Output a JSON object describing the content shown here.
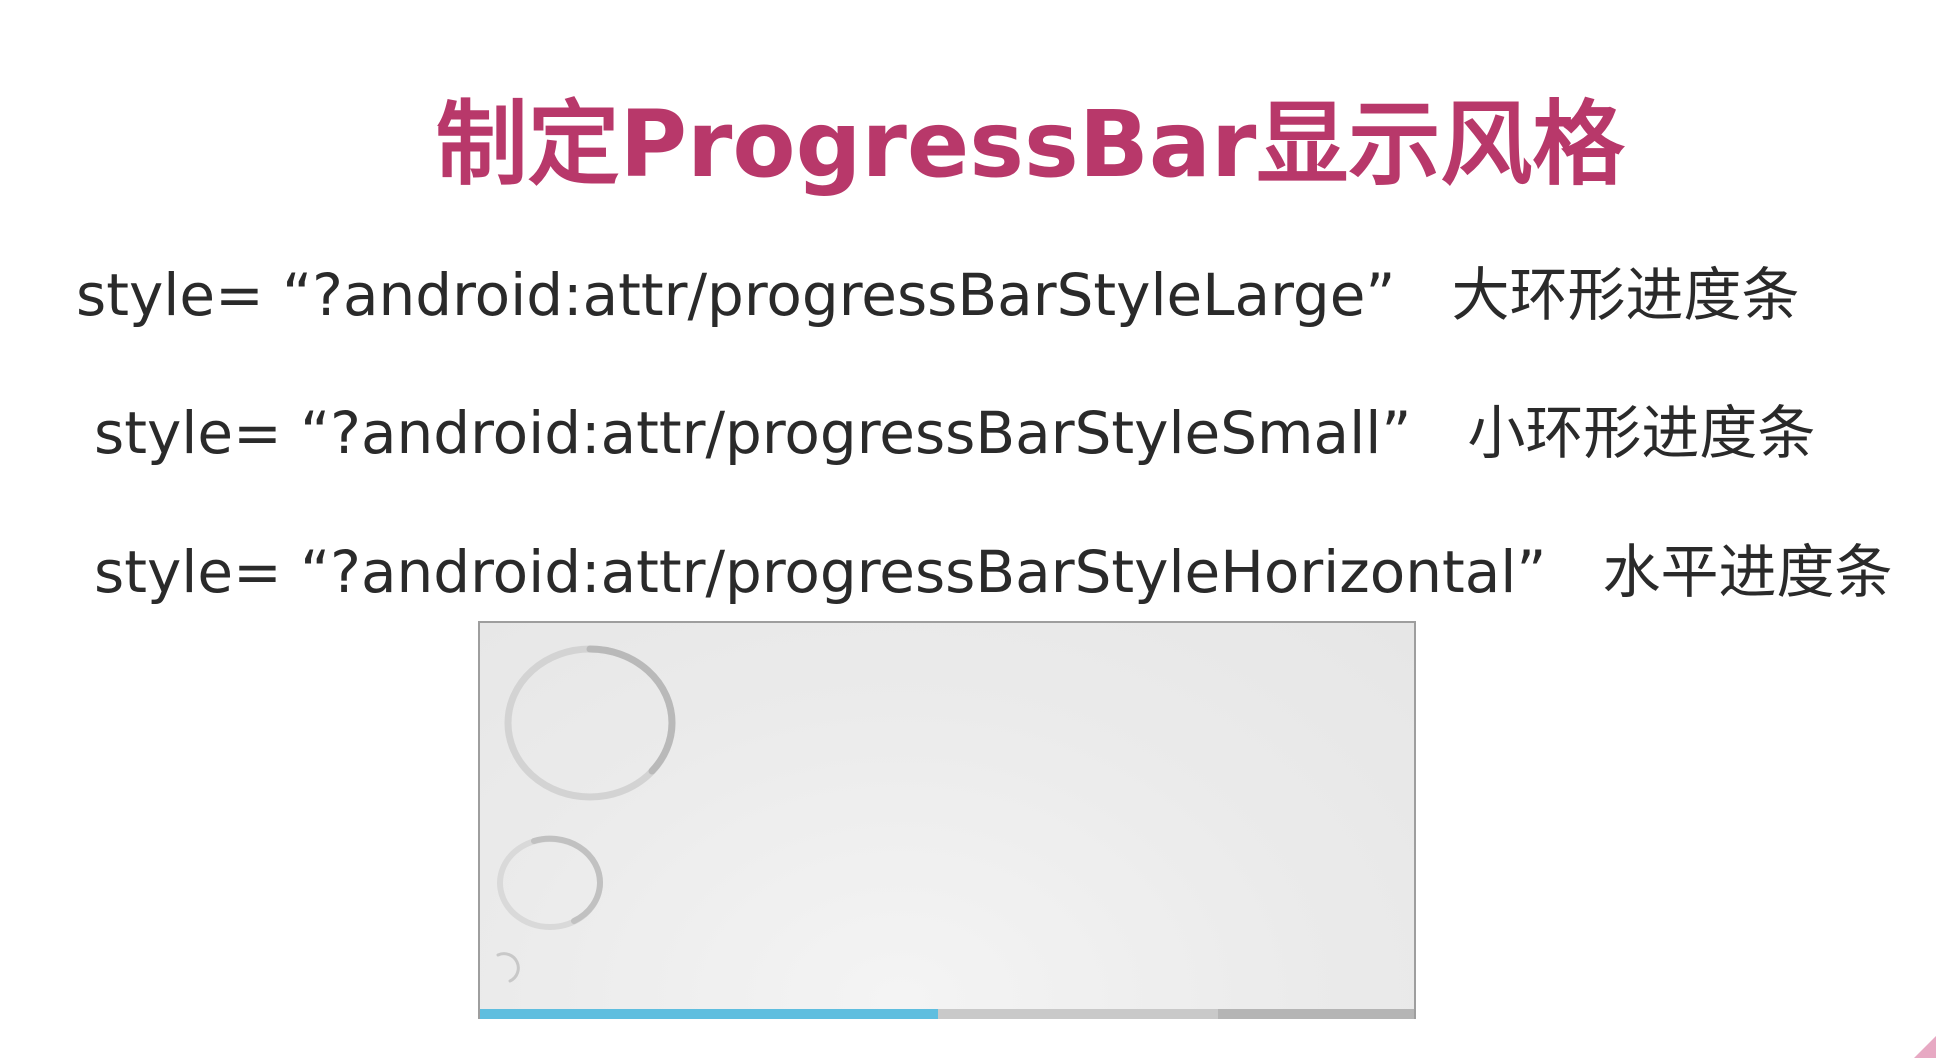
{
  "title": "制定ProgressBar显示风格",
  "styles": [
    {
      "code": "style=  “?android:attr/progressBarStyleLarge”",
      "desc": "大环形进度条"
    },
    {
      "code": "style=  “?android:attr/progressBarStyleSmall”",
      "desc": "小环形进度条"
    },
    {
      "code": "style=  “?android:attr/progressBarStyleHorizontal”",
      "desc": "水平进度条"
    }
  ],
  "demo": {
    "horizontal_progress": 0.49,
    "horizontal_secondary_progress": 0.79,
    "accent_color": "#5fbedf",
    "title_color": "#b8386a"
  }
}
